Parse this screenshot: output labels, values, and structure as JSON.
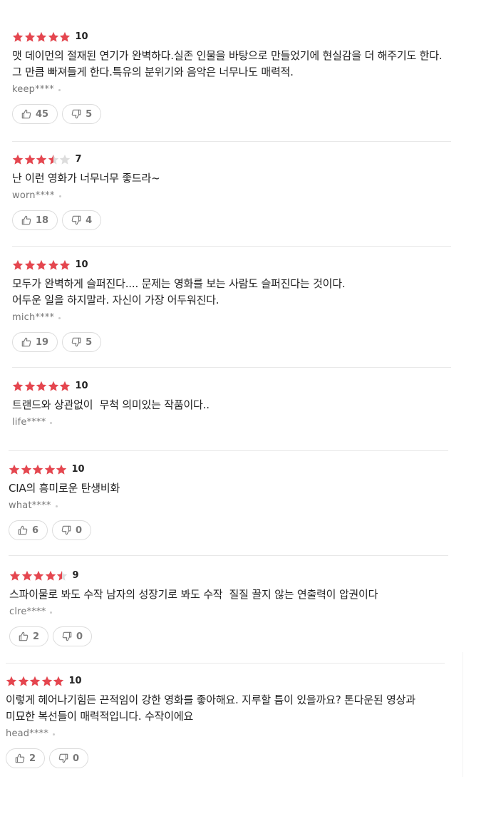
{
  "colors": {
    "star_filled": "#e5464f",
    "star_empty": "#dddddd",
    "text": "#222222",
    "meta": "#777777",
    "border": "#dcdcdc"
  },
  "icons": {
    "star": "star-icon",
    "like": "thumbs-up-icon",
    "dislike": "thumbs-down-icon"
  },
  "reviews": [
    {
      "stars": 5,
      "score": "10",
      "text": "맷 데이먼의 절재된 연기가 완벽하다.실존 인물을 바탕으로 만들었기에 현실감을 더 해주기도 한다. 그 만큼 빠져들게 한다.특유의 분위기와 음악은 너무나도 매력적.",
      "author": "keep****",
      "likes": "45",
      "dislikes": "5"
    },
    {
      "stars": 3.5,
      "score": "7",
      "text": "난 이런 영화가 너무너무 좋드라~",
      "author": "worn****",
      "likes": "18",
      "dislikes": "4"
    },
    {
      "stars": 5,
      "score": "10",
      "text": "모두가 완벽하게 슬퍼진다.... 문제는 영화를 보는 사람도 슬퍼진다는 것이다.\n어두운 일을 하지말라. 자신이 가장 어두워진다.",
      "author": "mich****",
      "likes": "19",
      "dislikes": "5"
    },
    {
      "stars": 5,
      "score": "10",
      "text": "트랜드와 상관없이  무척 의미있는 작품이다..",
      "author": "life****"
    },
    {
      "stars": 5,
      "score": "10",
      "text": "CIA의 흥미로운 탄생비화",
      "author": "what****",
      "likes": "6",
      "dislikes": "0"
    },
    {
      "stars": 4.5,
      "score": "9",
      "text": "스파이물로 봐도 수작 남자의 성장기로 봐도 수작  질질 끌지 않는 연출력이 압권이다",
      "author": "clre****",
      "likes": "2",
      "dislikes": "0"
    },
    {
      "stars": 5,
      "score": "10",
      "text": "이렇게 헤어나기힘든 끈적임이 강한 영화를 좋아해요. 지루할 틈이 있을까요? 톤다운된 영상과 미묘한 복선들이 매력적입니다. 수작이에요",
      "author": "head****",
      "likes": "2",
      "dislikes": "0"
    }
  ]
}
